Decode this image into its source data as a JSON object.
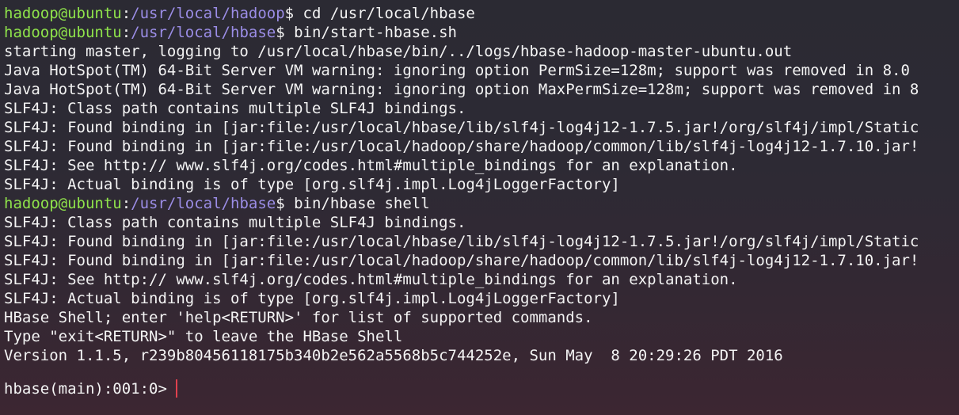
{
  "terminal": {
    "shell_prompts": [
      {
        "user": "hadoop@ubuntu",
        "sep": ":",
        "path": "/usr/local/hadoop",
        "sigil": "$",
        "command": " cd /usr/local/hbase"
      },
      {
        "user": "hadoop@ubuntu",
        "sep": ":",
        "path": "/usr/local/hbase",
        "sigil": "$",
        "command": " bin/start-hbase.sh"
      },
      {
        "user": "hadoop@ubuntu",
        "sep": ":",
        "path": "/usr/local/hbase",
        "sigil": "$",
        "command": " bin/hbase shell"
      }
    ],
    "output_block_1": [
      "starting master, logging to /usr/local/hbase/bin/../logs/hbase-hadoop-master-ubuntu.out",
      "Java HotSpot(TM) 64-Bit Server VM warning: ignoring option PermSize=128m; support was removed in 8.0",
      "Java HotSpot(TM) 64-Bit Server VM warning: ignoring option MaxPermSize=128m; support was removed in 8",
      "SLF4J: Class path contains multiple SLF4J bindings.",
      "SLF4J: Found binding in [jar:file:/usr/local/hbase/lib/slf4j-log4j12-1.7.5.jar!/org/slf4j/impl/Static",
      "SLF4J: Found binding in [jar:file:/usr/local/hadoop/share/hadoop/common/lib/slf4j-log4j12-1.7.10.jar!",
      "SLF4J: See http:// www.slf4j.org/codes.html#multiple_bindings for an explanation.",
      "SLF4J: Actual binding is of type [org.slf4j.impl.Log4jLoggerFactory]"
    ],
    "output_block_2": [
      "SLF4J: Class path contains multiple SLF4J bindings.",
      "SLF4J: Found binding in [jar:file:/usr/local/hbase/lib/slf4j-log4j12-1.7.5.jar!/org/slf4j/impl/Static",
      "SLF4J: Found binding in [jar:file:/usr/local/hadoop/share/hadoop/common/lib/slf4j-log4j12-1.7.10.jar!",
      "SLF4J: See http:// www.slf4j.org/codes.html#multiple_bindings for an explanation.",
      "SLF4J: Actual binding is of type [org.slf4j.impl.Log4jLoggerFactory]",
      "HBase Shell; enter 'help<RETURN>' for list of supported commands.",
      "Type \"exit<RETURN>\" to leave the HBase Shell",
      "Version 1.1.5, r239b80456118175b340b2e562a5568b5c744252e, Sun May  8 20:29:26 PDT 2016"
    ],
    "hbase_prompt": "hbase(main):001:0>",
    "colors": {
      "user": "#8fe34b",
      "path": "#9b8de6",
      "text": "#f4f4f4",
      "cursor": "#e0414f"
    }
  }
}
